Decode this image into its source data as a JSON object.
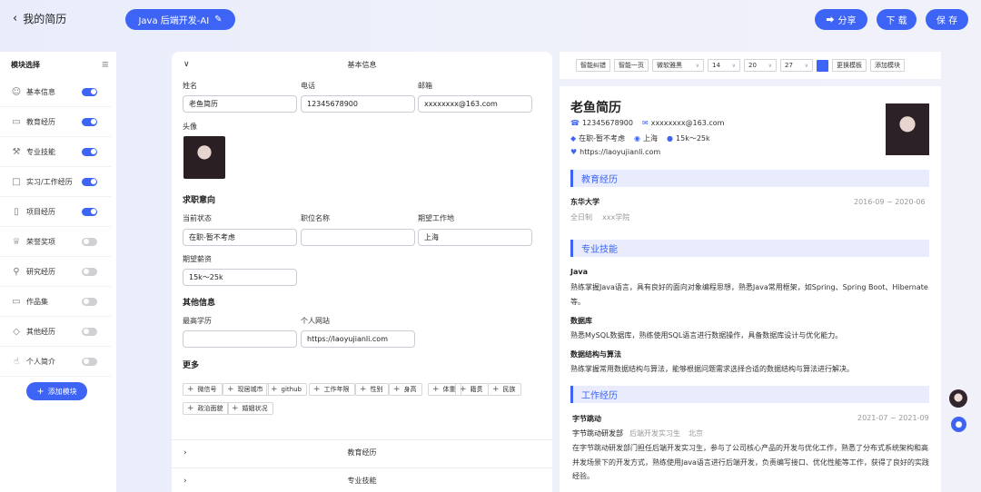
{
  "header": {
    "back_label": "我的简历",
    "resume_title": "Java 后端开发-AI",
    "share_label": "分享",
    "download_label": "下 载",
    "save_label": "保 存"
  },
  "sidebar": {
    "title": "模块选择",
    "items": [
      {
        "label": "基本信息",
        "icon": "user-icon",
        "on": true
      },
      {
        "label": "教育经历",
        "icon": "card-icon",
        "on": true
      },
      {
        "label": "专业技能",
        "icon": "wrench-icon",
        "on": true
      },
      {
        "label": "实习/工作经历",
        "icon": "laptop-icon",
        "on": true
      },
      {
        "label": "项目经历",
        "icon": "document-icon",
        "on": true
      },
      {
        "label": "荣誉奖项",
        "icon": "trophy-icon",
        "on": false
      },
      {
        "label": "研究经历",
        "icon": "search-icon",
        "on": false
      },
      {
        "label": "作品集",
        "icon": "monitor-icon",
        "on": false
      },
      {
        "label": "其他经历",
        "icon": "tag-icon",
        "on": false
      },
      {
        "label": "个人简介",
        "icon": "thumbs-up-icon",
        "on": false
      }
    ],
    "add_module_label": "添加模块"
  },
  "editor": {
    "basic_section_title": "基本信息",
    "name_label": "姓名",
    "name_value": "老鱼简历",
    "phone_label": "电话",
    "phone_value": "12345678900",
    "email_label": "邮箱",
    "email_value": "xxxxxxxx@163.com",
    "avatar_label": "头像",
    "intent_title": "求职意向",
    "status_label": "当前状态",
    "status_value": "在职-暂不考虑",
    "position_label": "职位名称",
    "position_value": "",
    "city_label": "期望工作地",
    "city_value": "上海",
    "salary_label": "期望薪资",
    "salary_value": "15k～25k",
    "other_title": "其他信息",
    "degree_label": "最高学历",
    "degree_value": "",
    "site_label": "个人网站",
    "site_value": "https://laoyujianli.com",
    "more_title": "更多",
    "tags": [
      "微信号",
      "现居城市",
      "github",
      "工作年限",
      "性别",
      "身高",
      "体重",
      "籍贯",
      "民族",
      "政治面貌",
      "婚姻状况"
    ],
    "collapsed_sections": [
      "教育经历",
      "专业技能"
    ]
  },
  "toolbar": {
    "smart_fix": "智能纠错",
    "smart_page": "智能一页",
    "font": "微软雅黑",
    "font_size": "14",
    "line_height": "20",
    "margin": "27",
    "accent_color": "#3d64f4",
    "change_template": "更换模板",
    "add_module": "添加模块"
  },
  "preview": {
    "name": "老鱼简历",
    "phone": "12345678900",
    "email": "xxxxxxxx@163.com",
    "status": "在职-暂不考虑",
    "city": "上海",
    "salary": "15k～25k",
    "site": "https://laoyujianli.com",
    "edu_title": "教育经历",
    "edu_school": "东华大学",
    "edu_dates": "2016-09 ~ 2020-06",
    "edu_type": "全日制",
    "edu_college": "xxx学院",
    "skills_title": "专业技能",
    "skill1_name": "Java",
    "skill1_desc": "熟练掌握Java语言，具有良好的面向对象编程思想，熟悉Java常用框架，如Spring、Spring Boot、Hibernate等。",
    "skill2_name": "数据库",
    "skill2_desc": "熟悉MySQL数据库，熟练使用SQL语言进行数据操作，具备数据库设计与优化能力。",
    "skill3_name": "数据结构与算法",
    "skill3_desc": "熟练掌握常用数据结构与算法，能够根据问题需求选择合适的数据结构与算法进行解决。",
    "work_title": "工作经历",
    "work_company": "字节跳动",
    "work_dates": "2021-07 ~ 2021-09",
    "work_dept": "字节跳动研发部",
    "work_role": "后端开发实习生",
    "work_city": "北京",
    "work_desc": "在字节跳动研发部门担任后端开发实习生，参与了公司核心产品的开发与优化工作，熟悉了分布式系统架构和高并发场景下的开发方式，熟练使用Java语言进行后端开发，负责编写接口、优化性能等工作，获得了良好的实践经验。"
  }
}
